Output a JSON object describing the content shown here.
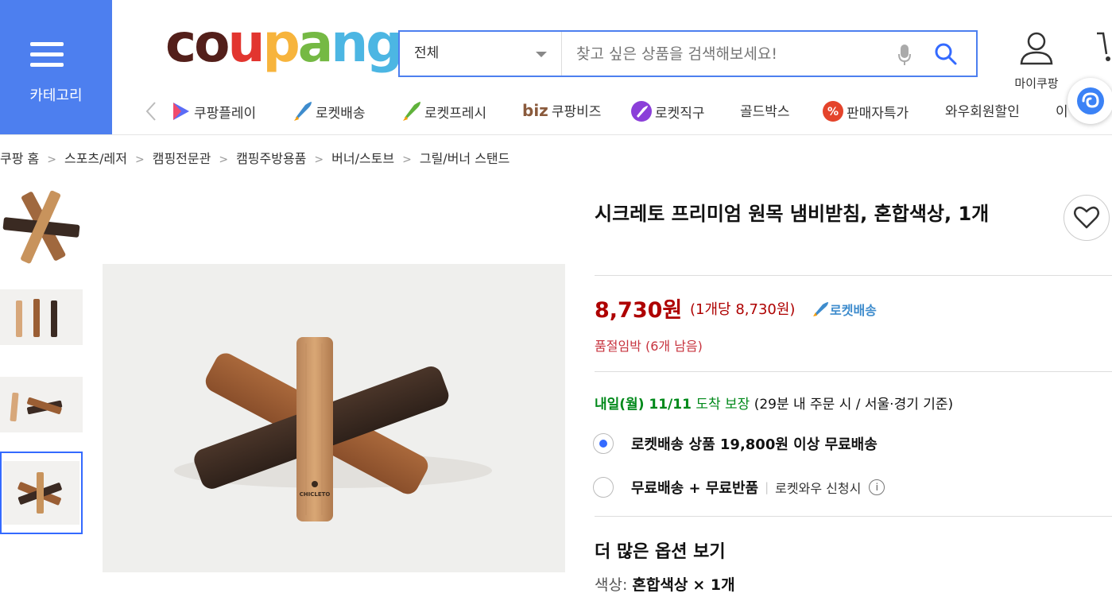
{
  "header": {
    "category_label": "카테고리",
    "logo": [
      "c",
      "o",
      "u",
      "p",
      "a",
      "ng"
    ],
    "search_scope": "전체",
    "search_placeholder": "찾고 싶은 상품을 검색해보세요!",
    "my_label": "마이쿠팡",
    "colors": {
      "brand_blue": "#4d7fef",
      "border_blue": "#346aff"
    }
  },
  "quick_menu": [
    {
      "label": "쿠팡플레이",
      "icon": "play-icon"
    },
    {
      "label": "로켓배송",
      "icon": "rocket-icon"
    },
    {
      "label": "로켓프레시",
      "icon": "rocket-fresh-icon"
    },
    {
      "label": "쿠팡비즈",
      "icon": "biz-icon",
      "prefix": "biz"
    },
    {
      "label": "로켓직구",
      "icon": "rocket-global-icon"
    },
    {
      "label": "골드박스",
      "icon": ""
    },
    {
      "label": "판매자특가",
      "icon": "percent-icon"
    },
    {
      "label": "와우회원할인",
      "icon": ""
    },
    {
      "label": "이",
      "icon": ""
    }
  ],
  "breadcrumb": [
    "쿠팡 홈",
    "스포츠/레저",
    "캠핑전문관",
    "캠핑주방용품",
    "버너/스토브",
    "그릴/버너 스탠드"
  ],
  "product": {
    "title": "시크레토 프리미엄 원목 냄비받침, 혼합색상, 1개",
    "price": "8,730원",
    "unit_price": "(1개당 8,730원)",
    "rocket_label": "로켓배송",
    "stock_notice": "품절임박 (6개 남음)",
    "delivery": {
      "date": "내일(월) 11/11",
      "guarantee": "도착 보장",
      "condition": "(29분  내 주문 시 / 서울·경기 기준)"
    },
    "options": [
      {
        "label": "로켓배송 상품 19,800원 이상 무료배송",
        "selected": true
      },
      {
        "label": "무료배송 + 무료반품",
        "extra": "로켓와우 신청시",
        "selected": false
      }
    ],
    "more_options_label": "더 많은 옵션 보기",
    "color_key": "색상:",
    "color_value": "혼합색상",
    "color_qty": "× 1개",
    "brand_mark": "CHICLETO"
  }
}
